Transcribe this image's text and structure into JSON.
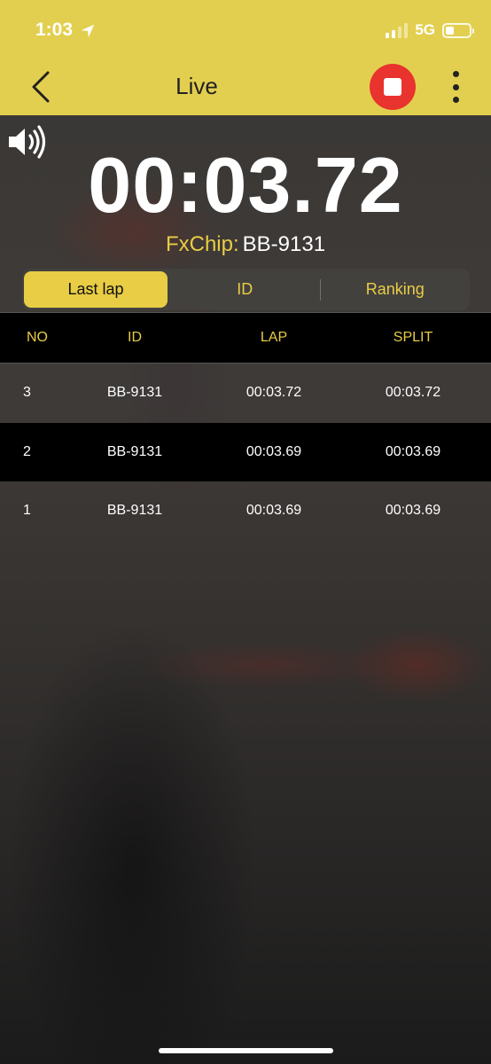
{
  "status_bar": {
    "time": "1:03",
    "network": "5G",
    "icons": [
      "location-arrow-icon",
      "signal-icon",
      "battery-icon"
    ]
  },
  "nav": {
    "title": "Live",
    "back_icon": "chevron-left-icon",
    "stop_icon": "stop-icon",
    "more_icon": "more-vertical-icon"
  },
  "timer": {
    "value": "00:03.72",
    "sound_icon": "speaker-icon"
  },
  "chip": {
    "label": "FxChip:",
    "value": "BB-9131"
  },
  "tabs": [
    {
      "label": "Last lap",
      "active": true
    },
    {
      "label": "ID",
      "active": false
    },
    {
      "label": "Ranking",
      "active": false
    }
  ],
  "table": {
    "columns": [
      "NO",
      "ID",
      "LAP",
      "SPLIT"
    ],
    "rows": [
      {
        "no": "3",
        "id": "BB-9131",
        "lap": "00:03.72",
        "split": "00:03.72"
      },
      {
        "no": "2",
        "id": "BB-9131",
        "lap": "00:03.69",
        "split": "00:03.69"
      },
      {
        "no": "1",
        "id": "BB-9131",
        "lap": "00:03.69",
        "split": "00:03.69"
      }
    ]
  },
  "colors": {
    "header_bg": "#e3cf4f",
    "accent": "#e8cd45",
    "stop_button": "#e8332e"
  }
}
